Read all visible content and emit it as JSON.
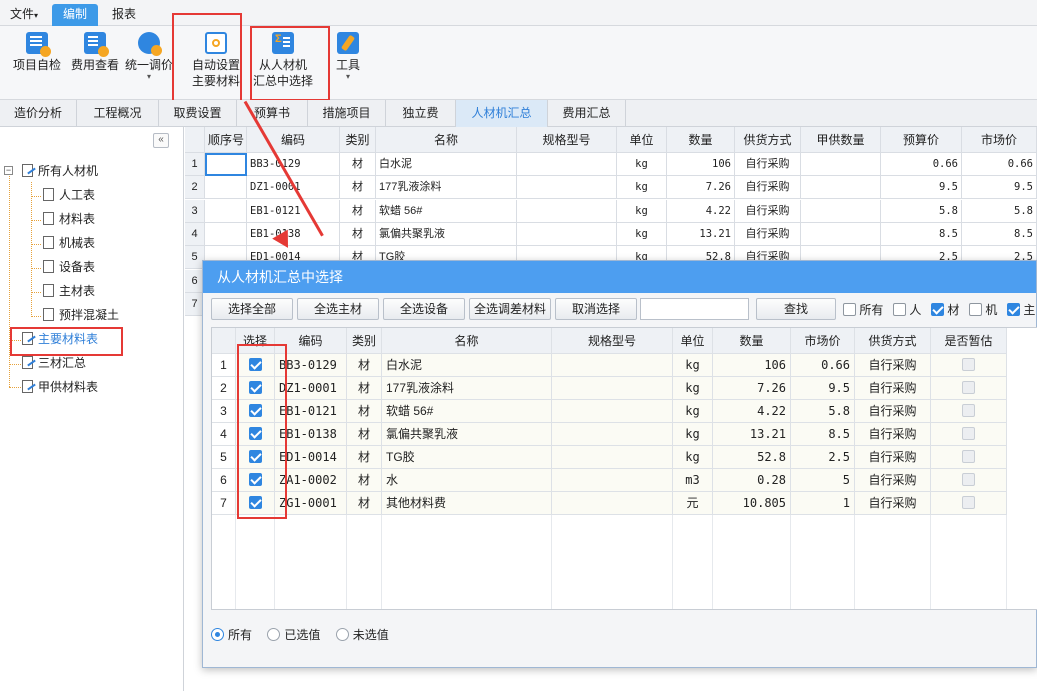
{
  "menu": {
    "items": [
      {
        "label": "文件",
        "caret": "▾"
      },
      {
        "label": "编制"
      },
      {
        "label": "报表"
      }
    ],
    "active_index": 1
  },
  "toolbar": {
    "items": [
      {
        "label": "项目自检",
        "icon": "check-doc-icon"
      },
      {
        "label": "费用查看",
        "icon": "cost-view-icon"
      },
      {
        "label": "统一调价",
        "icon": "adjust-price-icon",
        "caret": "▾"
      },
      {
        "label_line1": "自动设置",
        "label_line2": "主要材料",
        "icon": "auto-set-icon"
      },
      {
        "label_line1": "从人材机",
        "label_line2": "汇总中选择",
        "icon": "select-summary-icon"
      },
      {
        "label": "工具",
        "icon": "tools-icon",
        "caret": "▾"
      }
    ]
  },
  "tabs": [
    "造价分析",
    "工程概况",
    "取费设置",
    "预算书",
    "措施项目",
    "独立费",
    "人材机汇总",
    "费用汇总"
  ],
  "active_tab": "人材机汇总",
  "tree": {
    "collapse": "«",
    "expander": "−",
    "root": "所有人材机",
    "children": [
      "人工表",
      "材料表",
      "机械表",
      "设备表",
      "主材表",
      "预拌混凝土"
    ],
    "others": [
      "主要材料表",
      "三材汇总",
      "甲供材料表"
    ],
    "selected": "主要材料表"
  },
  "grid": {
    "headers": [
      "",
      "顺序号",
      "编码",
      "类别",
      "名称",
      "规格型号",
      "单位",
      "数量",
      "供货方式",
      "甲供数量",
      "预算价",
      "市场价"
    ],
    "rows": [
      [
        "1",
        "",
        "BB3-0129",
        "材",
        "白水泥",
        "",
        "kg",
        "106",
        "自行采购",
        "",
        "0.66",
        "0.66"
      ],
      [
        "2",
        "",
        "DZ1-0001",
        "材",
        "177乳液涂料",
        "",
        "kg",
        "7.26",
        "自行采购",
        "",
        "9.5",
        "9.5"
      ],
      [
        "3",
        "",
        "EB1-0121",
        "材",
        "软蜡 56#",
        "",
        "kg",
        "4.22",
        "自行采购",
        "",
        "5.8",
        "5.8"
      ],
      [
        "4",
        "",
        "EB1-0138",
        "材",
        "氯偏共聚乳液",
        "",
        "kg",
        "13.21",
        "自行采购",
        "",
        "8.5",
        "8.5"
      ],
      [
        "5",
        "",
        "ED1-0014",
        "材",
        "TG胶",
        "",
        "kg",
        "52.8",
        "自行采购",
        "",
        "2.5",
        "2.5"
      ],
      [
        "6",
        "",
        "",
        "",
        "",
        "",
        "",
        "",
        "",
        "",
        "",
        ""
      ],
      [
        "7",
        "",
        "",
        "",
        "",
        "",
        "",
        "",
        "",
        "",
        "",
        ""
      ]
    ]
  },
  "dialog": {
    "title": "从人材机汇总中选择",
    "buttons": [
      "选择全部",
      "全选主材",
      "全选设备",
      "全选调差材料",
      "取消选择",
      "查找"
    ],
    "search_value": "",
    "filters": [
      {
        "label": "所有",
        "checked": false
      },
      {
        "label": "人",
        "checked": false
      },
      {
        "label": "材",
        "checked": true
      },
      {
        "label": "机",
        "checked": false
      },
      {
        "label": "主",
        "checked": true
      }
    ],
    "headers": [
      "",
      "选择",
      "编码",
      "类别",
      "名称",
      "规格型号",
      "单位",
      "数量",
      "市场价",
      "供货方式",
      "是否暂估"
    ],
    "rows": [
      {
        "no": "1",
        "checked": true,
        "code": "BB3-0129",
        "type": "材",
        "name": "白水泥",
        "spec": "",
        "unit": "kg",
        "qty": "106",
        "price": "0.66",
        "supply": "自行采购"
      },
      {
        "no": "2",
        "checked": true,
        "code": "DZ1-0001",
        "type": "材",
        "name": "177乳液涂料",
        "spec": "",
        "unit": "kg",
        "qty": "7.26",
        "price": "9.5",
        "supply": "自行采购"
      },
      {
        "no": "3",
        "checked": true,
        "code": "EB1-0121",
        "type": "材",
        "name": "软蜡 56#",
        "spec": "",
        "unit": "kg",
        "qty": "4.22",
        "price": "5.8",
        "supply": "自行采购"
      },
      {
        "no": "4",
        "checked": true,
        "code": "EB1-0138",
        "type": "材",
        "name": "氯偏共聚乳液",
        "spec": "",
        "unit": "kg",
        "qty": "13.21",
        "price": "8.5",
        "supply": "自行采购"
      },
      {
        "no": "5",
        "checked": true,
        "code": "ED1-0014",
        "type": "材",
        "name": "TG胶",
        "spec": "",
        "unit": "kg",
        "qty": "52.8",
        "price": "2.5",
        "supply": "自行采购"
      },
      {
        "no": "6",
        "checked": true,
        "code": "ZA1-0002",
        "type": "材",
        "name": "水",
        "spec": "",
        "unit": "m3",
        "qty": "0.28",
        "price": "5",
        "supply": "自行采购"
      },
      {
        "no": "7",
        "checked": true,
        "code": "ZG1-0001",
        "type": "材",
        "name": "其他材料费",
        "spec": "",
        "unit": "元",
        "qty": "10.805",
        "price": "1",
        "supply": "自行采购"
      }
    ],
    "radios": [
      {
        "label": "所有",
        "on": true
      },
      {
        "label": "已选值",
        "on": false
      },
      {
        "label": "未选值",
        "on": false
      }
    ]
  },
  "colors": {
    "accent": "#3d9ae8",
    "dialog_title": "#4d9ef0",
    "highlight": "#e53935"
  }
}
